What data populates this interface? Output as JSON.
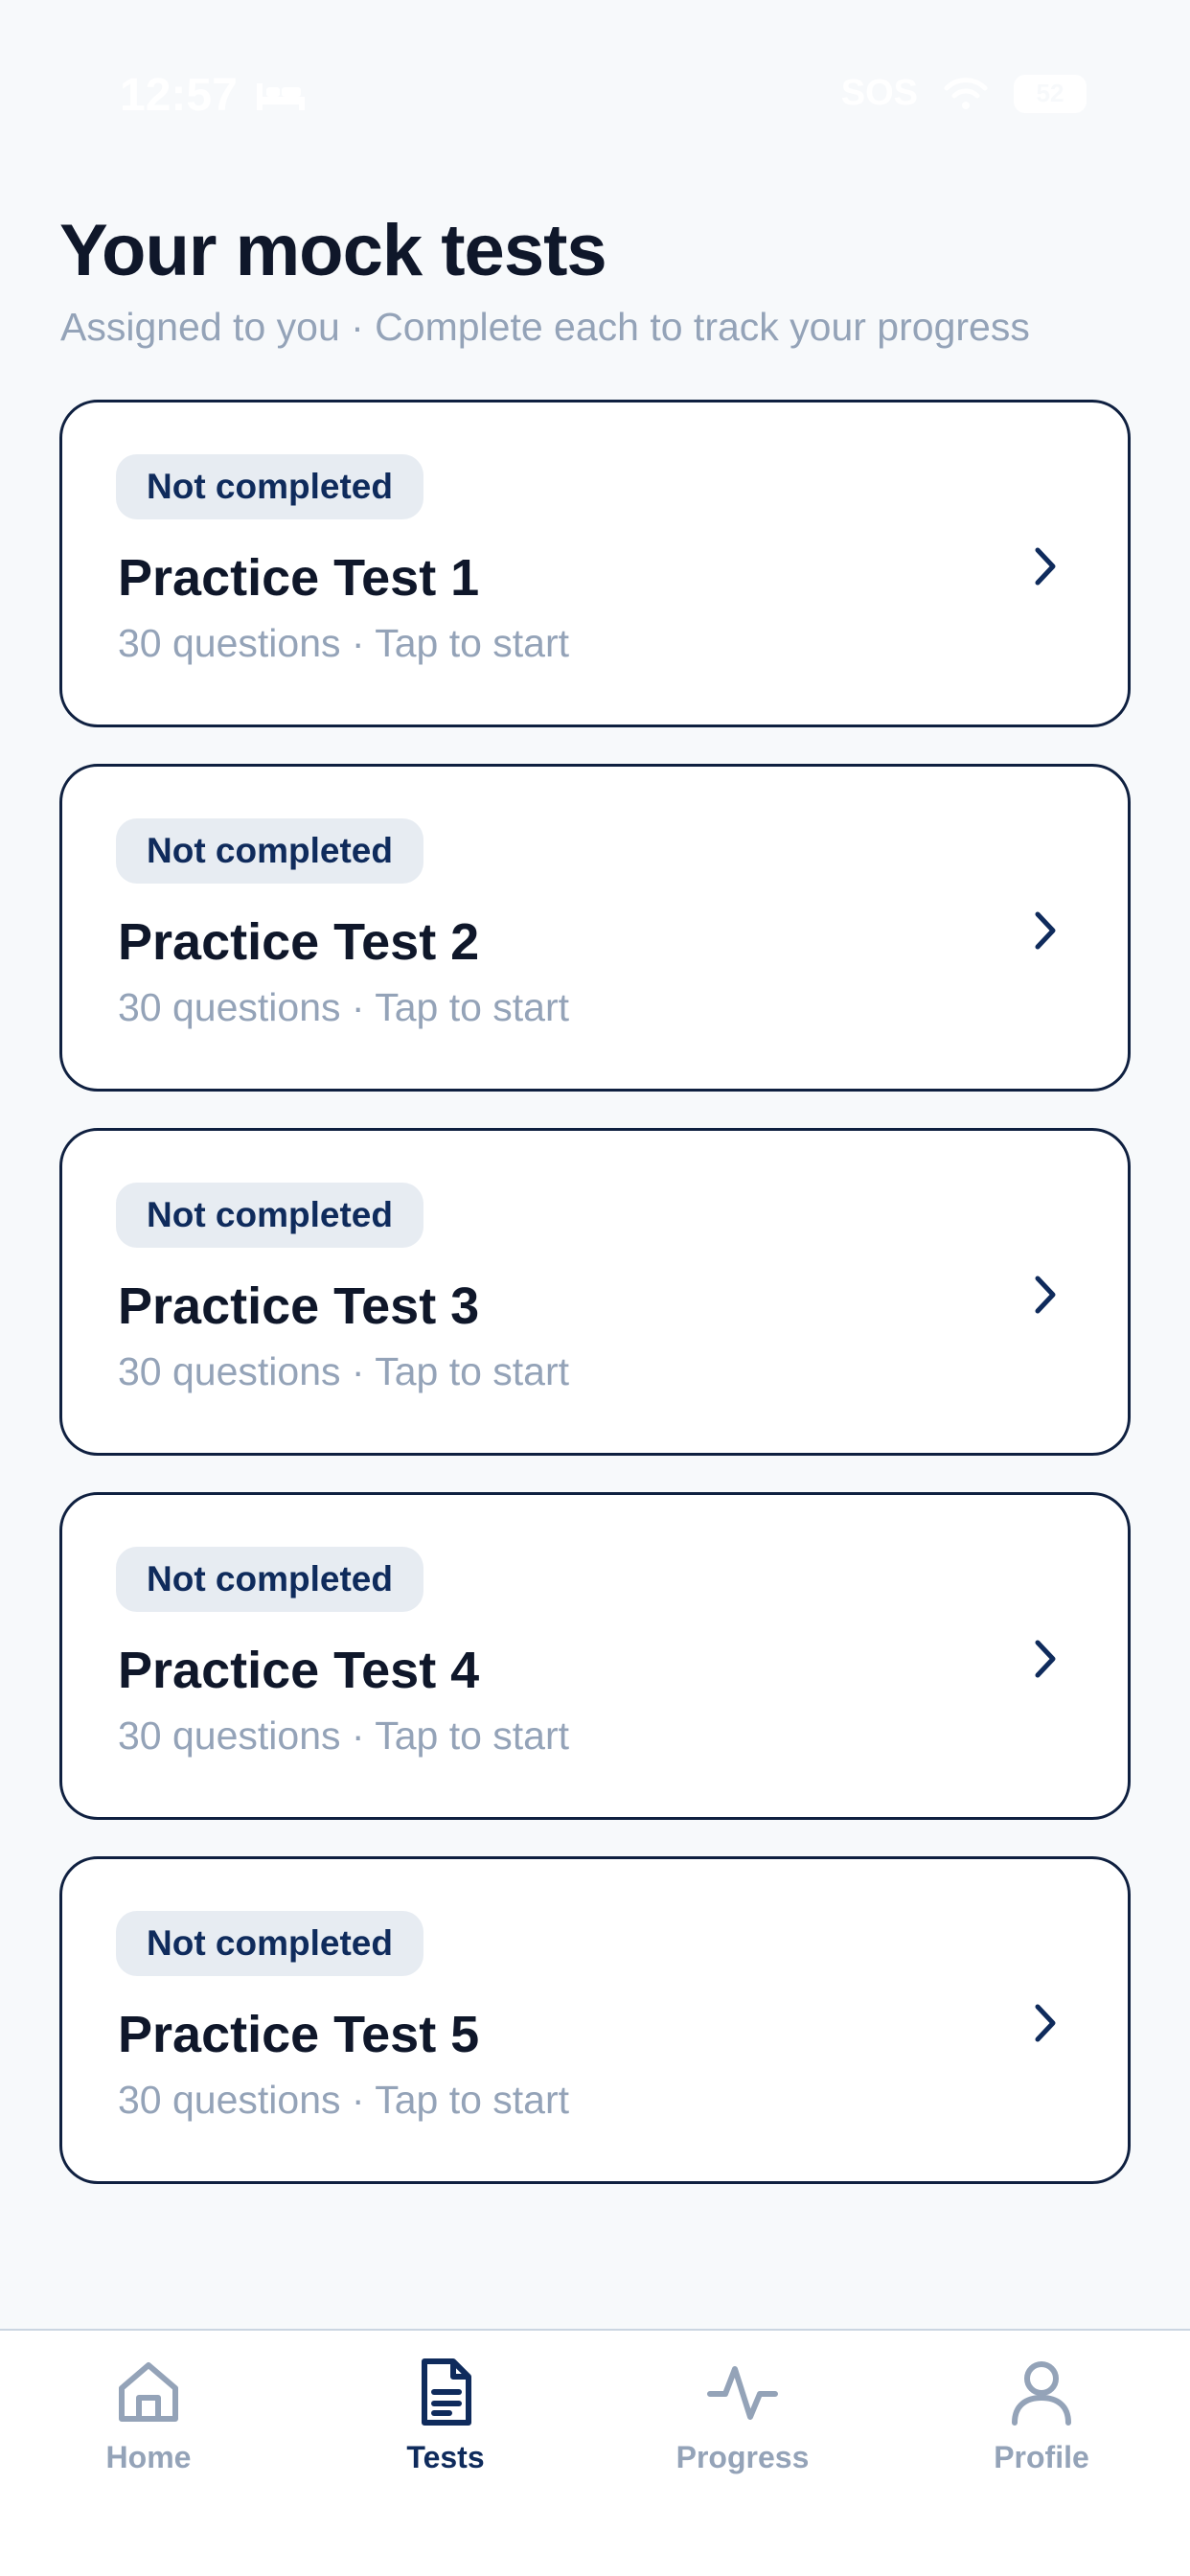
{
  "status_bar": {
    "time": "12:57",
    "sos": "SOS",
    "battery": "52"
  },
  "header": {
    "title": "Your mock tests",
    "subtitle": "Assigned to you · Complete each to track your progress"
  },
  "tests": [
    {
      "status": "Not completed",
      "title": "Practice Test 1",
      "meta": "30 questions · Tap to start"
    },
    {
      "status": "Not completed",
      "title": "Practice Test 2",
      "meta": "30 questions · Tap to start"
    },
    {
      "status": "Not completed",
      "title": "Practice Test 3",
      "meta": "30 questions · Tap to start"
    },
    {
      "status": "Not completed",
      "title": "Practice Test 4",
      "meta": "30 questions · Tap to start"
    },
    {
      "status": "Not completed",
      "title": "Practice Test 5",
      "meta": "30 questions · Tap to start"
    }
  ],
  "tab_bar": {
    "active": "tests",
    "tabs": [
      {
        "id": "home",
        "label": "Home",
        "icon": "home-icon"
      },
      {
        "id": "tests",
        "label": "Tests",
        "icon": "document-icon"
      },
      {
        "id": "progress",
        "label": "Progress",
        "icon": "activity-icon"
      },
      {
        "id": "profile",
        "label": "Profile",
        "icon": "user-icon"
      }
    ]
  },
  "colors": {
    "background": "#f7f9fb",
    "ink": "#0f172a",
    "accent": "#0f2b5c",
    "muted": "#94a3b8",
    "badge_bg": "#e7ecf2"
  }
}
